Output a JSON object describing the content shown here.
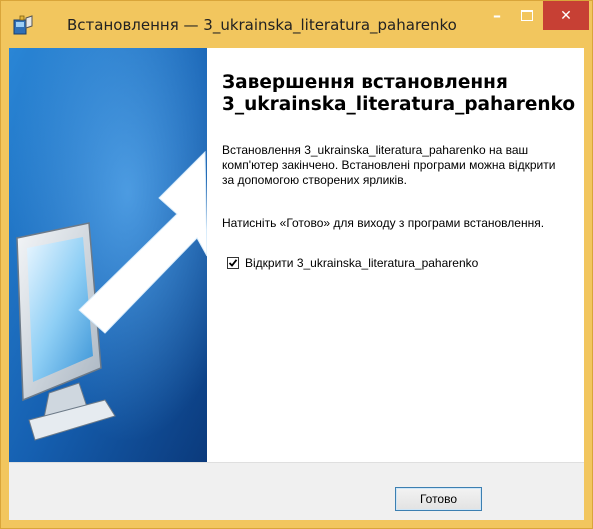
{
  "window": {
    "title": "Встановлення — 3_ukrainska_literatura_paharenko",
    "min_glyph": "–",
    "close_glyph": "✕"
  },
  "content": {
    "heading_line1": "Завершення встановлення",
    "heading_line2": "3_ukrainska_literatura_paharenko",
    "paragraph1": "Встановлення 3_ukrainska_literatura_paharenko на ваш комп'ютер закінчено. Встановлені програми можна відкрити за допомогою створених ярликів.",
    "paragraph2": "Натисніть «Готово» для виходу з програми встановлення.",
    "checkbox_label": "Відкрити 3_ukrainska_literatura_paharenko",
    "checkbox_checked": true
  },
  "footer": {
    "finish_label": "Готово"
  },
  "colors": {
    "titlebar": "#f2c65e",
    "close_button": "#c74034",
    "sidebar_top": "#1a6bc0",
    "sidebar_bottom": "#0d3f82"
  },
  "icons": {
    "app": "setup-icon",
    "sidebar": "computer-monitor-arrow-illustration"
  }
}
